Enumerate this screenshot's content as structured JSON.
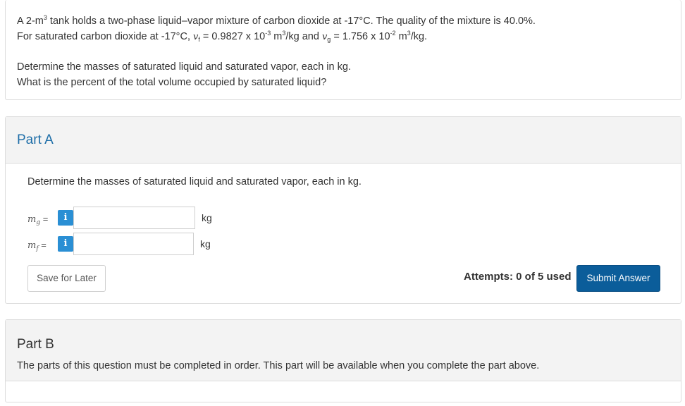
{
  "question": {
    "line1_a": "A 2-m",
    "line1_sup": "3",
    "line1_b": " tank holds a two-phase liquid–vapor mixture of carbon dioxide at -17°C. The quality of the mixture is 40.0%.",
    "line2_a": "For saturated carbon dioxide at -17°C, ",
    "vf_v": "v",
    "vf_sub": "f",
    "line2_b": " = 0.9827 x 10",
    "line2_exp1": "-3",
    "line2_c": " m",
    "line2_sup1": "3",
    "line2_d": "/kg and ",
    "vg_v": "v",
    "vg_sub": "g",
    "line2_e": " = 1.756 x 10",
    "line2_exp2": "-2",
    "line2_f": " m",
    "line2_sup2": "3",
    "line2_g": "/kg.",
    "line3": "Determine the masses of saturated liquid and saturated vapor, each in kg.",
    "line4": "What is the percent of the total volume occupied by saturated liquid?"
  },
  "partA": {
    "title": "Part A",
    "prompt": "Determine the masses of saturated liquid and saturated vapor, each in kg.",
    "fields": [
      {
        "var": "m",
        "sub": "g",
        "eq": " =",
        "info": "i",
        "value": "",
        "unit": "kg"
      },
      {
        "var": "m",
        "sub": "f",
        "eq": " =",
        "info": "i",
        "value": "",
        "unit": "kg"
      }
    ],
    "save_label": "Save for Later",
    "attempts_label": "Attempts: ",
    "attempts_value": "0 of 5 used",
    "submit_label": "Submit Answer"
  },
  "partB": {
    "title": "Part B",
    "note": "The parts of this question must be completed in order. This part will be available when you complete the part above."
  },
  "colors": {
    "accent": "#1e6ea8",
    "submit": "#0b5d9a",
    "info": "#2a8fd4",
    "header_bg": "#f3f3f3"
  }
}
